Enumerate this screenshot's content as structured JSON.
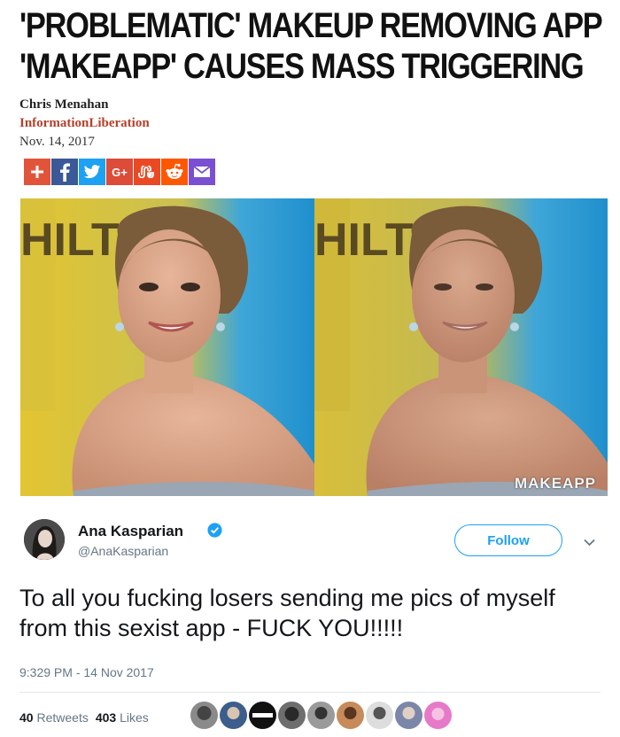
{
  "article": {
    "headline_line1": "'PROBLEMATIC' MAKEUP REMOVING APP",
    "headline_line2": "'MAKEAPP' CAUSES MASS TRIGGERING",
    "author": "Chris Menahan",
    "outlet": "InformationLiberation",
    "date": "Nov. 14, 2017",
    "share_buttons": [
      {
        "name": "share-add-icon",
        "color": "#e2543a",
        "glyph": "+"
      },
      {
        "name": "facebook-icon",
        "color": "#3b5998",
        "glyph": "f"
      },
      {
        "name": "twitter-icon",
        "color": "#1da1f2",
        "glyph": "bird"
      },
      {
        "name": "google-plus-icon",
        "color": "#dd4b39",
        "glyph": "G+"
      },
      {
        "name": "stumbleupon-icon",
        "color": "#eb4924",
        "glyph": "su"
      },
      {
        "name": "reddit-icon",
        "color": "#ff5700",
        "glyph": "reddit"
      },
      {
        "name": "email-icon",
        "color": "#7b4fd1",
        "glyph": "mail"
      }
    ],
    "photo_backdrop_text": "HILT",
    "watermark": "MAKEAPP"
  },
  "tweet": {
    "display_name": "Ana Kasparian",
    "handle": "@AnaKasparian",
    "follow_label": "Follow",
    "text": "To all you fucking losers sending me pics of myself from this sexist app - FUCK YOU!!!!!",
    "timestamp": "9:329 PM - 14 Nov 2017",
    "retweets_count": "40",
    "retweets_label": "Retweets",
    "likes_count": "403",
    "likes_label": "Likes",
    "accent_color": "#1da1f2"
  }
}
